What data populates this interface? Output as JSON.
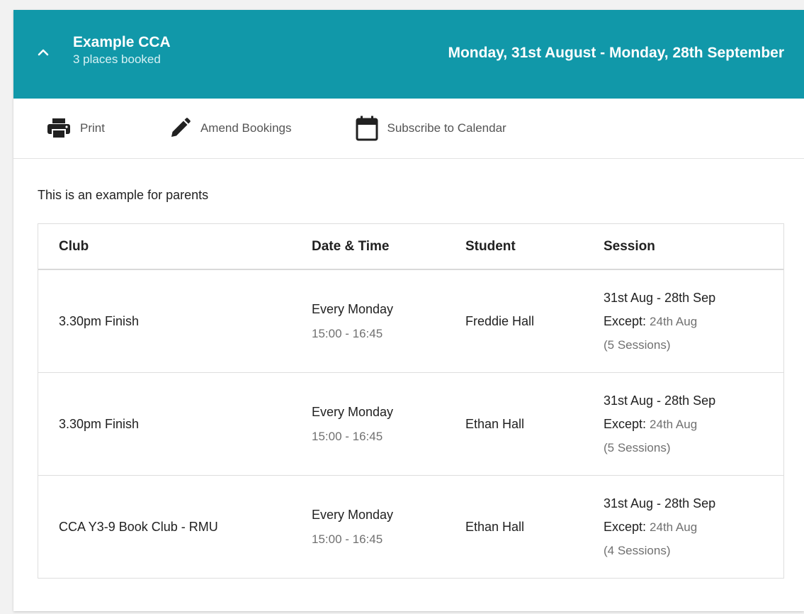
{
  "header": {
    "title": "Example CCA",
    "subtitle": "3 places booked",
    "dates": "Monday, 31st August - Monday, 28th September"
  },
  "toolbar": {
    "print_label": "Print",
    "amend_label": "Amend Bookings",
    "subscribe_label": "Subscribe to Calendar"
  },
  "description": "This is an example for parents",
  "table": {
    "headers": {
      "club": "Club",
      "date_time": "Date & Time",
      "student": "Student",
      "session": "Session"
    },
    "rows": [
      {
        "club": "3.30pm Finish",
        "day": "Every Monday",
        "time": "15:00 - 16:45",
        "student": "Freddie Hall",
        "range": "31st Aug - 28th Sep",
        "except_label": "Except:",
        "except_value": "24th Aug",
        "sessions": "(5 Sessions)"
      },
      {
        "club": "3.30pm Finish",
        "day": "Every Monday",
        "time": "15:00 - 16:45",
        "student": "Ethan Hall",
        "range": "31st Aug - 28th Sep",
        "except_label": "Except:",
        "except_value": "24th Aug",
        "sessions": "(5 Sessions)"
      },
      {
        "club": "CCA Y3-9 Book Club - RMU",
        "day": "Every Monday",
        "time": "15:00 - 16:45",
        "student": "Ethan Hall",
        "range": "31st Aug - 28th Sep",
        "except_label": "Except:",
        "except_value": "24th Aug",
        "sessions": "(4 Sessions)"
      }
    ]
  },
  "colors": {
    "header_bg": "#1198a9",
    "header_text": "#ffffff",
    "icon": "#212121",
    "muted_text": "#707070"
  },
  "icons": {
    "collapse": "chevron-up-icon",
    "print": "printer-icon",
    "amend": "pencil-icon",
    "subscribe": "calendar-icon"
  }
}
